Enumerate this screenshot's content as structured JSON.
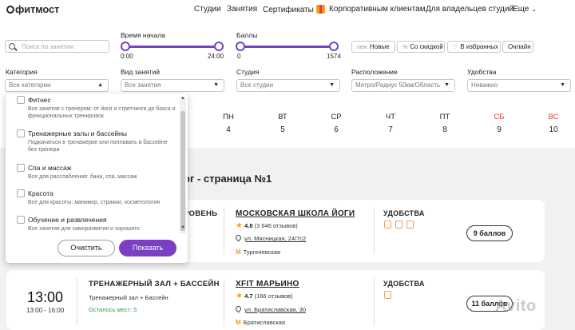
{
  "header": {
    "logo": "фитмост",
    "nav": [
      "Студии",
      "Занятия",
      "Сертификаты",
      "Корпоративным клиентам",
      "Для владельцев студий",
      "Еще"
    ]
  },
  "filters": {
    "search_placeholder": "Поиск по занятии",
    "time_label": "Время начала",
    "time_min": "0:00",
    "time_max": "24:00",
    "points_label": "Баллы",
    "points_min": "0",
    "points_max": "1574",
    "chips": [
      {
        "pre": "new",
        "label": "Новые"
      },
      {
        "pre": "%",
        "label": "Со скидкой"
      },
      {
        "pre": "♡",
        "label": "В избранных"
      },
      {
        "pre": "",
        "label": "Онлайн"
      }
    ],
    "category_label": "Категория",
    "category_value": "Все категории",
    "type_label": "Вид занятий",
    "type_value": "Все занятия",
    "studio_label": "Студия",
    "studio_value": "Все студии",
    "location_label": "Расположение",
    "location_value": "Метро/Радиус 50км/Область",
    "amenities_label": "Удобства",
    "amenities_value": "Неважно"
  },
  "days": [
    {
      "name": "ПН",
      "num": "4",
      "weekend": false
    },
    {
      "name": "ВТ",
      "num": "5",
      "weekend": false
    },
    {
      "name": "СР",
      "num": "6",
      "weekend": false
    },
    {
      "name": "ЧТ",
      "num": "7",
      "weekend": false
    },
    {
      "name": "ПТ",
      "num": "8",
      "weekend": false
    },
    {
      "name": "СБ",
      "num": "9",
      "weekend": true
    },
    {
      "name": "ВС",
      "num": "10",
      "weekend": true
    }
  ],
  "page_heading": "ог - страница №1",
  "dropdown": {
    "options": [
      {
        "title": "Фитнес",
        "desc": "Все занятия с тренером: от йоги и стретчинга до бокса и функциональных тренировок"
      },
      {
        "title": "Тренажерные залы и бассейны",
        "desc": "Подкачаться в тренажерке или поплавать в бассейне без тренера"
      },
      {
        "title": "Спа и массаж",
        "desc": "Все для расслабления: бани, спа, массаж"
      },
      {
        "title": "Красота",
        "desc": "Все для красоты: маникюр, стрижки, косметология"
      },
      {
        "title": "Обучение и развлечения",
        "desc": "Все занятия для саморазвития и хорошего"
      }
    ],
    "clear_label": "Очистить",
    "show_label": "Показать"
  },
  "cards": [
    {
      "class_title_partial": "РОВЕНЬ",
      "studio": "МОСКОВСКАЯ ШКОЛА ЙОГИ",
      "rating": "4.8",
      "reviews": "(3 646 отзывов)",
      "address": "ул. Мясницкая, 24/7с2",
      "metro": "Тургеневская",
      "amenities_label": "УДОБСТВА",
      "price": "9 баллов"
    },
    {
      "time": "13:00",
      "time_range": "13:00 - 16:00",
      "class_title": "ТРЕНАЖЕРНЫЙ ЗАЛ + БАССЕЙН",
      "class_sub": "Тренажерный зал + Бассейн",
      "seats": "Осталось мест: 5",
      "studio": "XFIT МАРЬИНО",
      "rating": "4.7",
      "reviews": "(166 отзывов)",
      "address": "ул. Братиславская, 30",
      "metro": "Братиславская",
      "amenities_label": "УДОБСТВА",
      "price": "11 баллов"
    }
  ],
  "watermark": "Avito",
  "colors": {
    "accent": "#7b3fc4",
    "weekend": "#e04040",
    "seats": "#2e9e3a",
    "metro": "#f39a2d",
    "star": "#f5a623"
  }
}
